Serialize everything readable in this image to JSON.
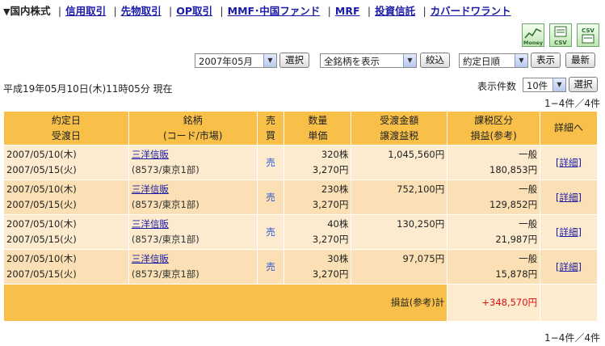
{
  "nav": {
    "current": "国内株式",
    "links": [
      "信用取引",
      "先物取引",
      "OP取引",
      "MMF･中国ファンド",
      "MRF",
      "投資信託",
      "カバードワラント"
    ]
  },
  "icons": [
    "chart-money-icon",
    "csv-icon",
    "csv-download-icon"
  ],
  "filters": {
    "month": "2007年05月",
    "select_label": "選択",
    "stock_filter": "全銘柄を表示",
    "narrow_label": "絞込",
    "sort": "約定日順",
    "show_label": "表示",
    "refresh_label": "最新"
  },
  "timestamp": "平成19年05月10日(木)11時05分 現在",
  "display_count": {
    "label": "表示件数",
    "value": "10件",
    "select_label": "選択"
  },
  "range_text": "1−4件／4件",
  "table": {
    "headers": [
      [
        "約定日",
        "受渡日"
      ],
      [
        "銘柄",
        "(コード/市場)"
      ],
      [
        "売",
        "買"
      ],
      [
        "数量",
        "単価"
      ],
      [
        "受渡金額",
        "譲渡益税"
      ],
      [
        "課税区分",
        "損益(参考)"
      ],
      [
        "詳細へ"
      ]
    ],
    "rows": [
      {
        "trade_date": "2007/05/10(木)",
        "settle_date": "2007/05/15(火)",
        "name": "三洋信販",
        "code": "(8573/東京1部)",
        "side": "売",
        "qty": "320株",
        "price": "3,270円",
        "amount": "1,045,560円",
        "tax": "",
        "tax_class": "一般",
        "pl": "180,853円",
        "detail": "[詳細]"
      },
      {
        "trade_date": "2007/05/10(木)",
        "settle_date": "2007/05/15(火)",
        "name": "三洋信販",
        "code": "(8573/東京1部)",
        "side": "売",
        "qty": "230株",
        "price": "3,270円",
        "amount": "752,100円",
        "tax": "",
        "tax_class": "一般",
        "pl": "129,852円",
        "detail": "[詳細]"
      },
      {
        "trade_date": "2007/05/10(木)",
        "settle_date": "2007/05/15(火)",
        "name": "三洋信販",
        "code": "(8573/東京1部)",
        "side": "売",
        "qty": "40株",
        "price": "3,270円",
        "amount": "130,250円",
        "tax": "",
        "tax_class": "一般",
        "pl": "21,987円",
        "detail": "[詳細]"
      },
      {
        "trade_date": "2007/05/10(木)",
        "settle_date": "2007/05/15(火)",
        "name": "三洋信販",
        "code": "(8573/東京1部)",
        "side": "売",
        "qty": "30株",
        "price": "3,270円",
        "amount": "97,075円",
        "tax": "",
        "tax_class": "一般",
        "pl": "15,878円",
        "detail": "[詳細]"
      }
    ],
    "total_label": "損益(参考)計",
    "total_value": "+348,570円"
  }
}
